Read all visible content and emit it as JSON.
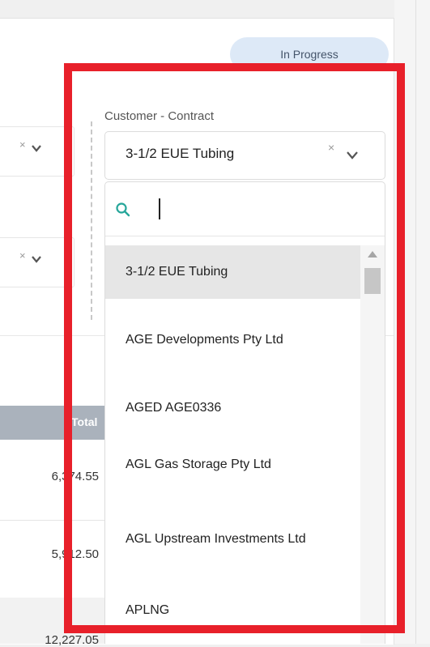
{
  "status_badge": "In Progress",
  "field_label": "Customer - Contract",
  "selected_value": "3-1/2 EUE Tubing",
  "clear_glyph": "×",
  "search": {
    "value": ""
  },
  "options": [
    "3-1/2 EUE Tubing",
    "AGE Developments Pty Ltd",
    "AGED AGE0336",
    "AGL Gas Storage Pty Ltd",
    "AGL Upstream Investments Ltd",
    "APLNG"
  ],
  "table": {
    "header": "Total",
    "rows": [
      "6,374.55",
      "5,912.50",
      "12,227.05"
    ]
  },
  "colors": {
    "highlight": "#e8202a",
    "accent": "#26a69a",
    "badge_bg": "#dde9f7"
  },
  "icons": [
    "chevron-down-icon",
    "clear-icon",
    "search-icon",
    "scroll-up-icon"
  ]
}
